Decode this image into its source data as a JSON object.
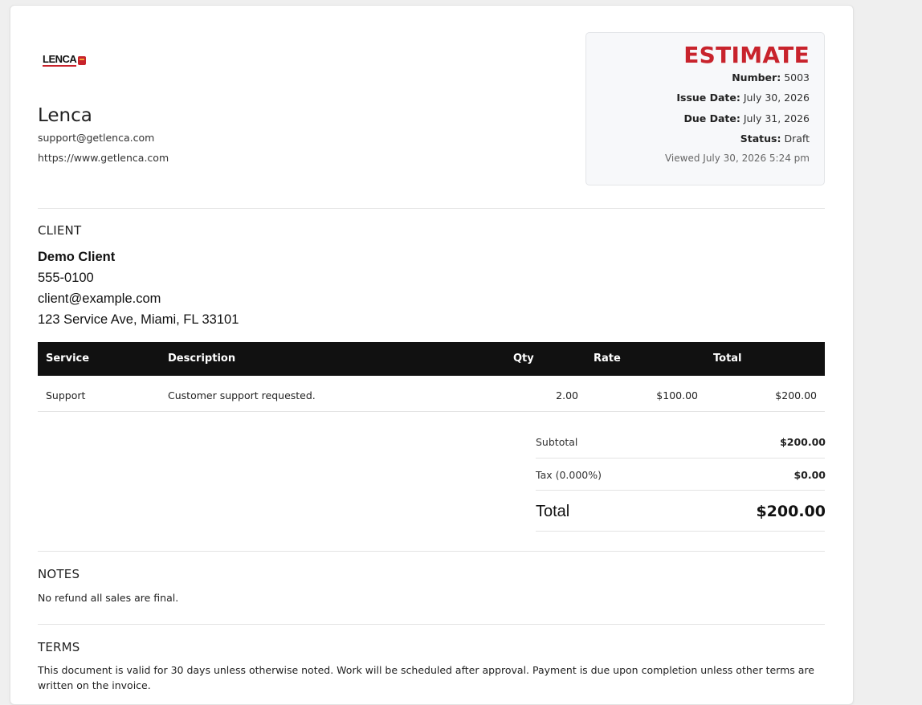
{
  "company": {
    "logo_text": "LENCA",
    "name": "Lenca",
    "email": "support@getlenca.com",
    "website": "https://www.getlenca.com"
  },
  "estimate": {
    "title": "ESTIMATE",
    "number_label": "Number:",
    "number": "5003",
    "issue_label": "Issue Date:",
    "issue_date": "July 30, 2026",
    "due_label": "Due Date:",
    "due_date": "July 31, 2026",
    "status_label": "Status:",
    "status": "Draft",
    "viewed": "Viewed July 30, 2026 5:24 pm"
  },
  "client": {
    "section_title": "CLIENT",
    "name": "Demo Client",
    "phone": "555-0100",
    "email": "client@example.com",
    "address": "123 Service Ave, Miami, FL 33101"
  },
  "table": {
    "headers": [
      "Service",
      "Description",
      "Qty",
      "Rate",
      "Total"
    ],
    "rows": [
      {
        "service": "Support",
        "description": "Customer support requested.",
        "qty": "2.00",
        "rate": "$100.00",
        "total": "$200.00"
      }
    ]
  },
  "summary": {
    "subtotal_label": "Subtotal",
    "subtotal": "$200.00",
    "tax_label": "Tax (0.000%)",
    "tax": "$0.00",
    "total_label": "Total",
    "total": "$200.00"
  },
  "notes": {
    "title": "NOTES",
    "text": "No refund all sales are final."
  },
  "terms": {
    "title": "TERMS",
    "text": "This document is valid for 30 days unless otherwise noted. Work will be scheduled after approval. Payment is due upon completion unless other terms are written on the invoice."
  }
}
